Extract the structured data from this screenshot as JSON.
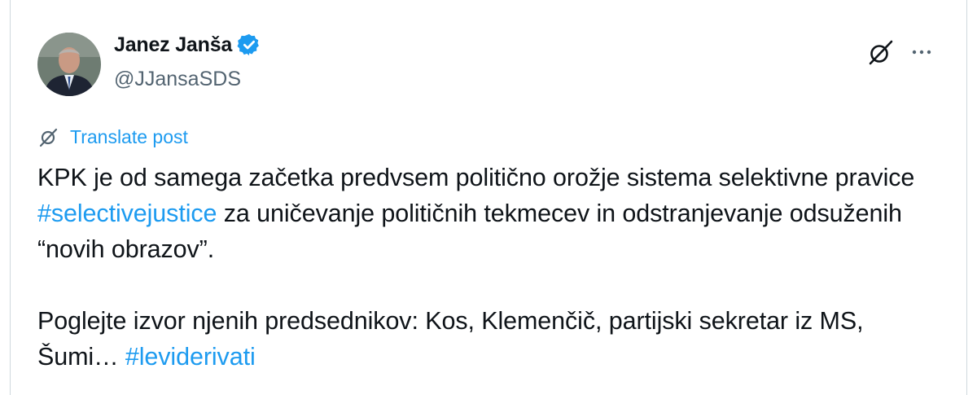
{
  "author": {
    "display_name": "Janez Janša",
    "handle": "@JJansaSDS",
    "verified": true
  },
  "translate_label": "Translate post",
  "post": {
    "p1_a": "KPK je od samega začetka predvsem politično orožje sistema selektivne pravice ",
    "p1_tag": "#selectivejustice",
    "p1_b": " za uničevanje političnih tekmecev in odstranjevanje odsuženih “novih obrazov”.",
    "p2_a": "Poglejte izvor njenih predsednikov: Kos, Klemenčič, partijski sekretar iz MS, Šumi… ",
    "p2_tag": "#leviderivati"
  },
  "icons": {
    "avatar": "avatar-photo",
    "verified": "verified-badge-icon",
    "grok": "grok-icon",
    "more": "more-icon",
    "translate": "grok-icon"
  },
  "colors": {
    "link": "#1d9bf0",
    "secondary_text": "#536471",
    "primary_text": "#0f1419",
    "border": "#cfd9de"
  }
}
